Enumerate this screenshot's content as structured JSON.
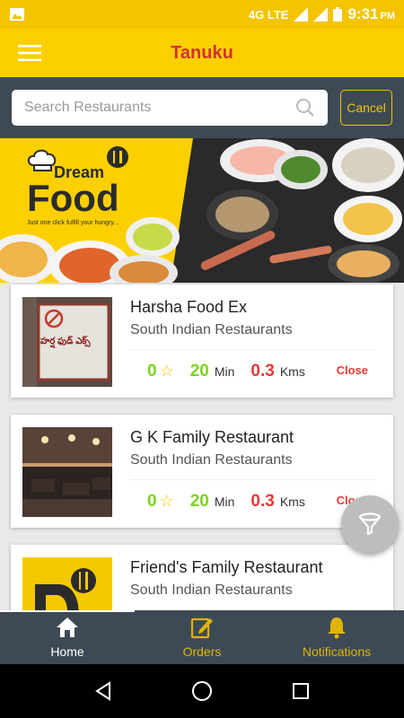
{
  "status_bar": {
    "network": "4G LTE",
    "time": "9:31",
    "ampm": "PM"
  },
  "app_bar": {
    "title": "Tanuku"
  },
  "search": {
    "placeholder": "Search Restaurants",
    "value": "",
    "cancel_label": "Cancel"
  },
  "banner": {
    "logo_top": "Dream",
    "logo_main": "Food",
    "tagline": "Just one click fulfill your hungry..."
  },
  "restaurants": [
    {
      "name": "Harsha Food Ex",
      "type": "South Indian Restaurants",
      "rating": "0",
      "time": "20",
      "time_unit": "Min",
      "distance": "0.3",
      "distance_unit": "Kms",
      "status": "Close",
      "thumb_text": "హర్ష ఫుడ్ ఎక్స్"
    },
    {
      "name": "G K Family Restaurant",
      "type": "South Indian Restaurants",
      "rating": "0",
      "time": "20",
      "time_unit": "Min",
      "distance": "0.3",
      "distance_unit": "Kms",
      "status": "Close"
    },
    {
      "name": "Friend's Family Restaurant",
      "type": "South Indian Restaurants"
    }
  ],
  "bottom_nav": [
    {
      "label": "Home",
      "icon": "home-icon",
      "active": true
    },
    {
      "label": "Orders",
      "icon": "edit-icon",
      "active": false
    },
    {
      "label": "Notifications",
      "icon": "bell-icon",
      "active": false
    }
  ],
  "colors": {
    "primary": "#fcd000",
    "title_red": "#d32f2f",
    "nav_bg": "#3d4a55",
    "green": "#7ed321",
    "red": "#e53935",
    "accent_gold": "#e0b400"
  }
}
